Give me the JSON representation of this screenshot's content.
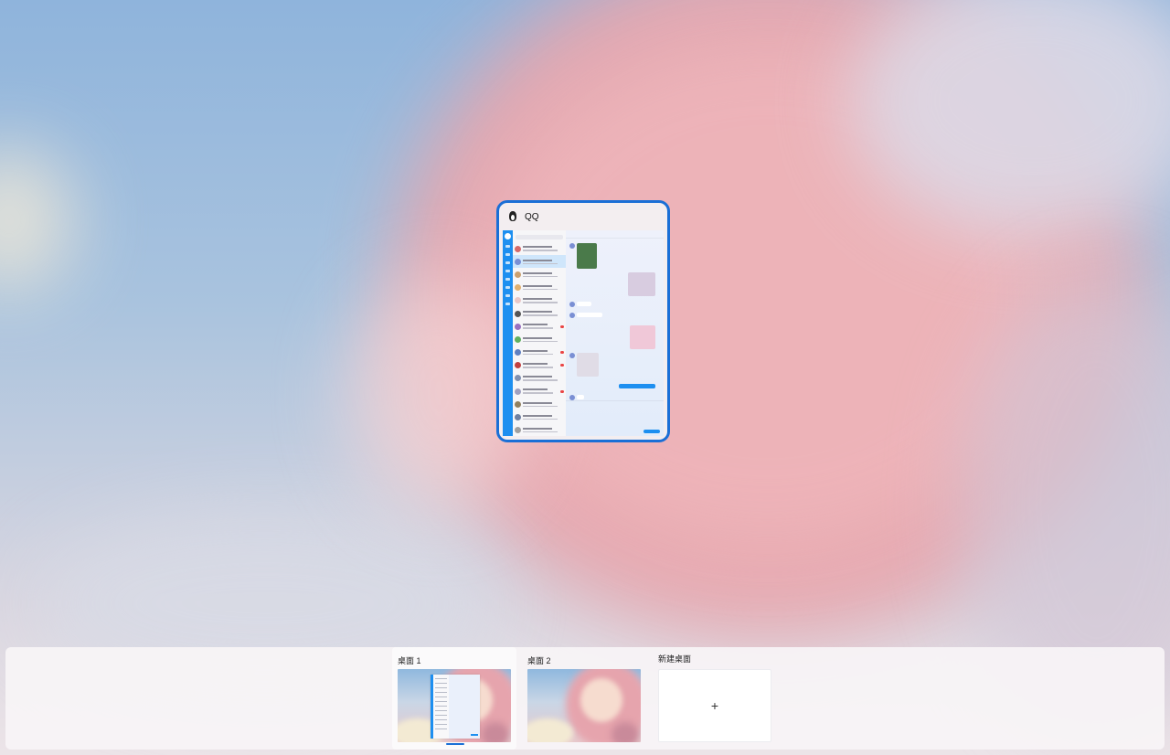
{
  "window_preview": {
    "app_title": "QQ",
    "app_icon": "qq-penguin-icon"
  },
  "desktops": [
    {
      "label": "桌面 1",
      "active": true
    },
    {
      "label": "桌面 2",
      "active": false
    }
  ],
  "new_desktop": {
    "label": "新建桌面",
    "icon": "+"
  },
  "colors": {
    "accent": "#1a6fd6",
    "qq_blue": "#1d8ff0"
  }
}
